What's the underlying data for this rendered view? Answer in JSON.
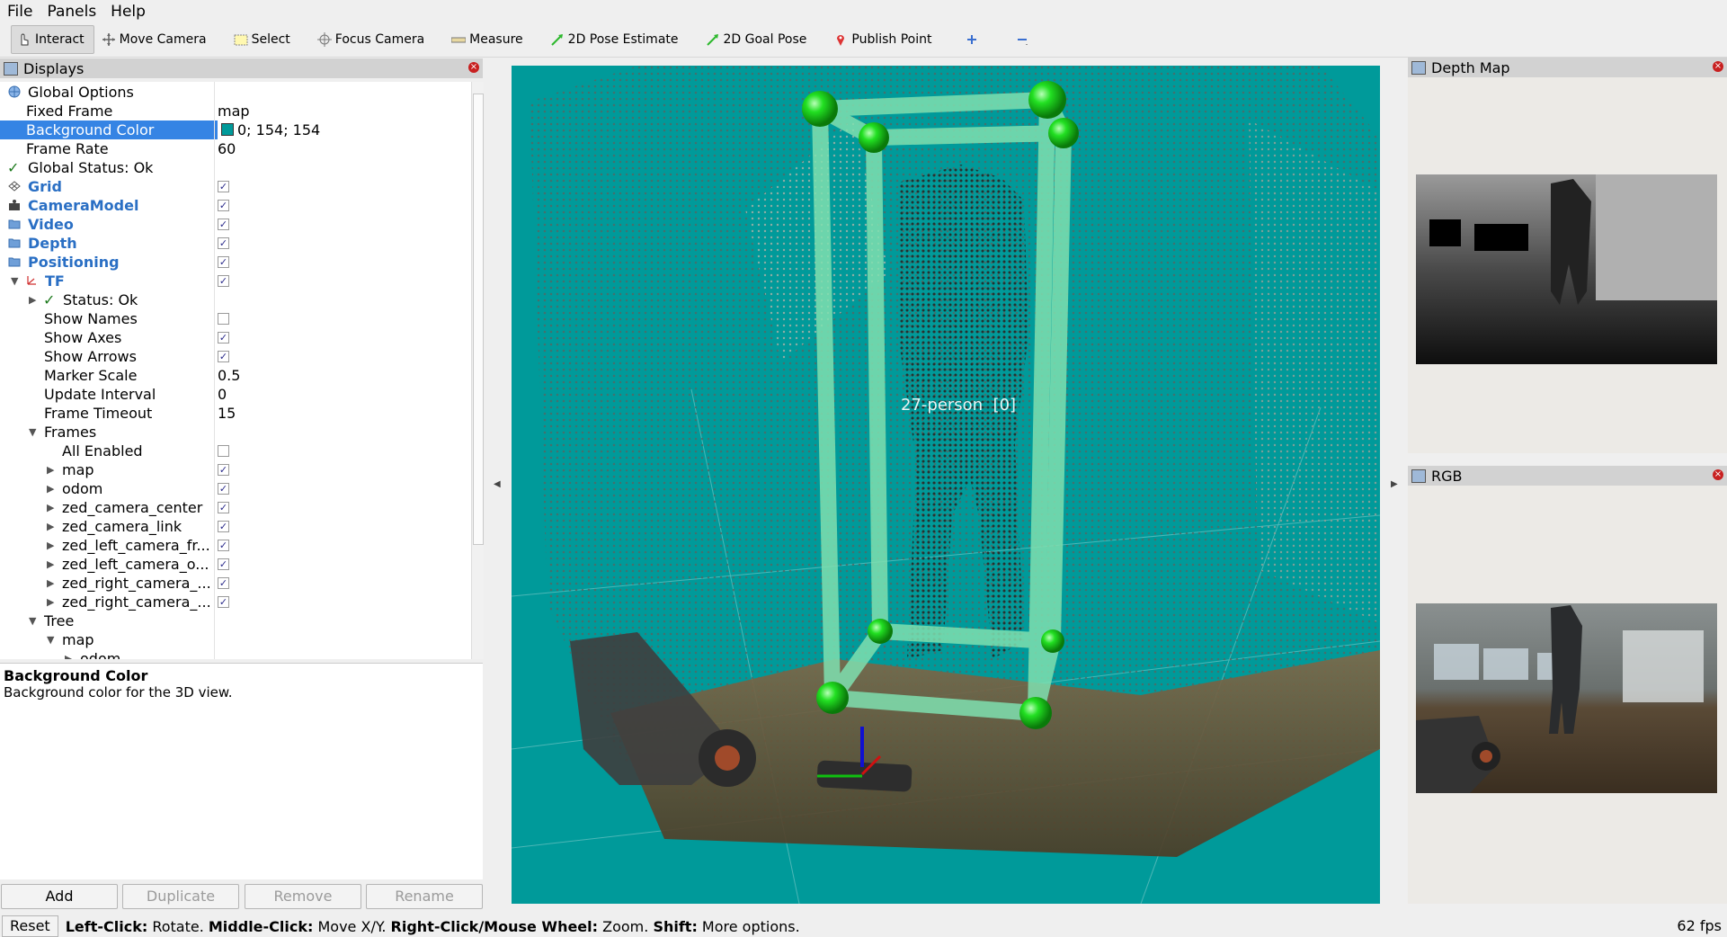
{
  "menubar": {
    "items": [
      {
        "label": "File"
      },
      {
        "label": "Panels"
      },
      {
        "label": "Help"
      }
    ]
  },
  "toolbar": {
    "tools": [
      {
        "label": "Interact",
        "icon": "hand-cursor-icon",
        "active": true
      },
      {
        "label": "Move Camera",
        "icon": "move-arrows-icon"
      },
      {
        "label": "Select",
        "icon": "select-rect-icon"
      },
      {
        "label": "Focus Camera",
        "icon": "focus-target-icon"
      },
      {
        "label": "Measure",
        "icon": "ruler-icon"
      },
      {
        "label": "2D Pose Estimate",
        "icon": "green-arrow-icon"
      },
      {
        "label": "2D Goal Pose",
        "icon": "green-arrow-icon"
      },
      {
        "label": "Publish Point",
        "icon": "red-pin-icon"
      }
    ]
  },
  "displays": {
    "title": "Displays",
    "rows": [
      {
        "label": "Global Options",
        "value": ""
      },
      {
        "label": "Fixed Frame",
        "value": "map"
      },
      {
        "label": "Background Color",
        "value": "0; 154; 154"
      },
      {
        "label": "Frame Rate",
        "value": "60"
      },
      {
        "label": "Global Status: Ok",
        "value": ""
      },
      {
        "label": "Grid",
        "value": ""
      },
      {
        "label": "CameraModel",
        "value": ""
      },
      {
        "label": "Video",
        "value": ""
      },
      {
        "label": "Depth",
        "value": ""
      },
      {
        "label": "Positioning",
        "value": ""
      },
      {
        "label": "TF",
        "value": ""
      },
      {
        "label": "Status: Ok",
        "value": ""
      },
      {
        "label": "Show Names",
        "value": ""
      },
      {
        "label": "Show Axes",
        "value": ""
      },
      {
        "label": "Show Arrows",
        "value": ""
      },
      {
        "label": "Marker Scale",
        "value": "0.5"
      },
      {
        "label": "Update Interval",
        "value": "0"
      },
      {
        "label": "Frame Timeout",
        "value": "15"
      },
      {
        "label": "Frames",
        "value": ""
      },
      {
        "label": "All Enabled",
        "value": ""
      },
      {
        "label": "map",
        "value": ""
      },
      {
        "label": "odom",
        "value": ""
      },
      {
        "label": "zed_camera_center",
        "value": ""
      },
      {
        "label": "zed_camera_link",
        "value": ""
      },
      {
        "label": "zed_left_camera_fr...",
        "value": ""
      },
      {
        "label": "zed_left_camera_o...",
        "value": ""
      },
      {
        "label": "zed_right_camera_...",
        "value": ""
      },
      {
        "label": "zed_right_camera_...",
        "value": ""
      },
      {
        "label": "Tree",
        "value": ""
      },
      {
        "label": "map",
        "value": ""
      },
      {
        "label": "odom",
        "value": ""
      }
    ],
    "background_color_swatch": "#009a9a",
    "selection_color": "#3584e4"
  },
  "description": {
    "title": "Background Color",
    "text": "Background color for the 3D view."
  },
  "buttons": {
    "add": "Add",
    "duplicate": "Duplicate",
    "remove": "Remove",
    "rename": "Rename"
  },
  "viewport": {
    "label": "27-person  [0]",
    "background": "#009a9a"
  },
  "panels": {
    "depth_title": "Depth Map",
    "rgb_title": "RGB"
  },
  "status": {
    "reset": "Reset",
    "hint_parts": [
      "Left-Click:",
      " Rotate. ",
      "Middle-Click:",
      " Move X/Y. ",
      "Right-Click/Mouse Wheel:",
      " Zoom. ",
      "Shift:",
      " More options."
    ],
    "fps": "62 fps"
  }
}
